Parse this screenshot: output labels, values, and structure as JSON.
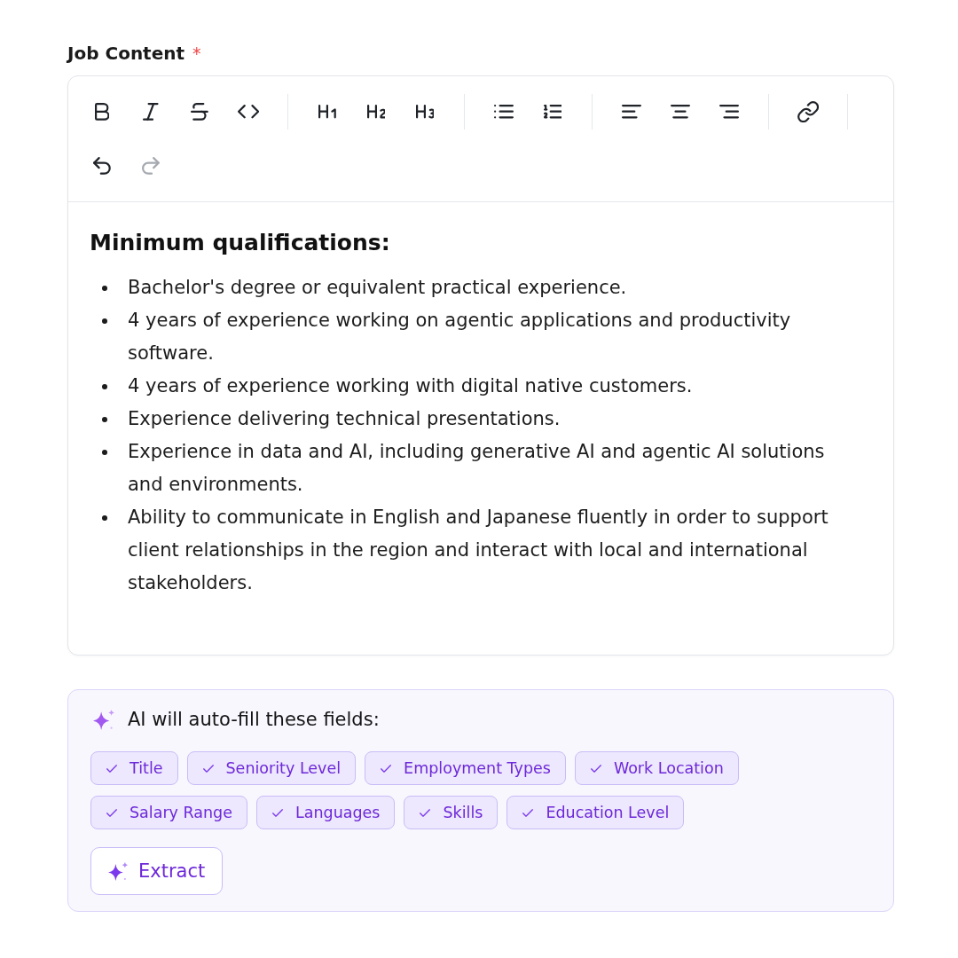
{
  "field": {
    "label": "Job Content",
    "required_mark": "*"
  },
  "editor": {
    "toolbar": [
      {
        "buttons": [
          {
            "kind": "bold",
            "disabled": false
          },
          {
            "kind": "italic",
            "disabled": false
          },
          {
            "kind": "strike",
            "disabled": false
          },
          {
            "kind": "code",
            "disabled": false
          }
        ]
      },
      {
        "buttons": [
          {
            "kind": "h1",
            "disabled": false
          },
          {
            "kind": "h2",
            "disabled": false
          },
          {
            "kind": "h3",
            "disabled": false
          }
        ]
      },
      {
        "buttons": [
          {
            "kind": "bullet_list",
            "disabled": false
          },
          {
            "kind": "ordered_list",
            "disabled": false
          }
        ]
      },
      {
        "buttons": [
          {
            "kind": "align_left",
            "disabled": false
          },
          {
            "kind": "align_center",
            "disabled": false
          },
          {
            "kind": "align_right",
            "disabled": false
          }
        ]
      },
      {
        "buttons": [
          {
            "kind": "link",
            "disabled": false
          }
        ]
      },
      {
        "buttons": [
          {
            "kind": "undo",
            "disabled": false
          },
          {
            "kind": "redo",
            "disabled": true
          }
        ]
      }
    ],
    "content": {
      "heading": "Minimum qualifications:",
      "bullets": [
        "Bachelor's degree or equivalent practical experience.",
        "4 years of experience working on agentic applications and productivity software.",
        "4 years of experience working with digital native customers.",
        "Experience delivering technical presentations.",
        "Experience in data and AI, including generative AI and agentic AI solutions and environments.",
        "Ability to communicate in English and Japanese fluently in order to support client relationships in the region and interact with local and international stakeholders."
      ]
    }
  },
  "ai_panel": {
    "title": "AI will auto-fill these fields:",
    "fields": [
      {
        "label": "Title",
        "checked": true
      },
      {
        "label": "Seniority Level",
        "checked": true
      },
      {
        "label": "Employment Types",
        "checked": true
      },
      {
        "label": "Work Location",
        "checked": true
      },
      {
        "label": "Salary Range",
        "checked": true
      },
      {
        "label": "Languages",
        "checked": true
      },
      {
        "label": "Skills",
        "checked": true
      },
      {
        "label": "Education Level",
        "checked": true
      }
    ],
    "extract_button": {
      "label": "Extract"
    }
  }
}
